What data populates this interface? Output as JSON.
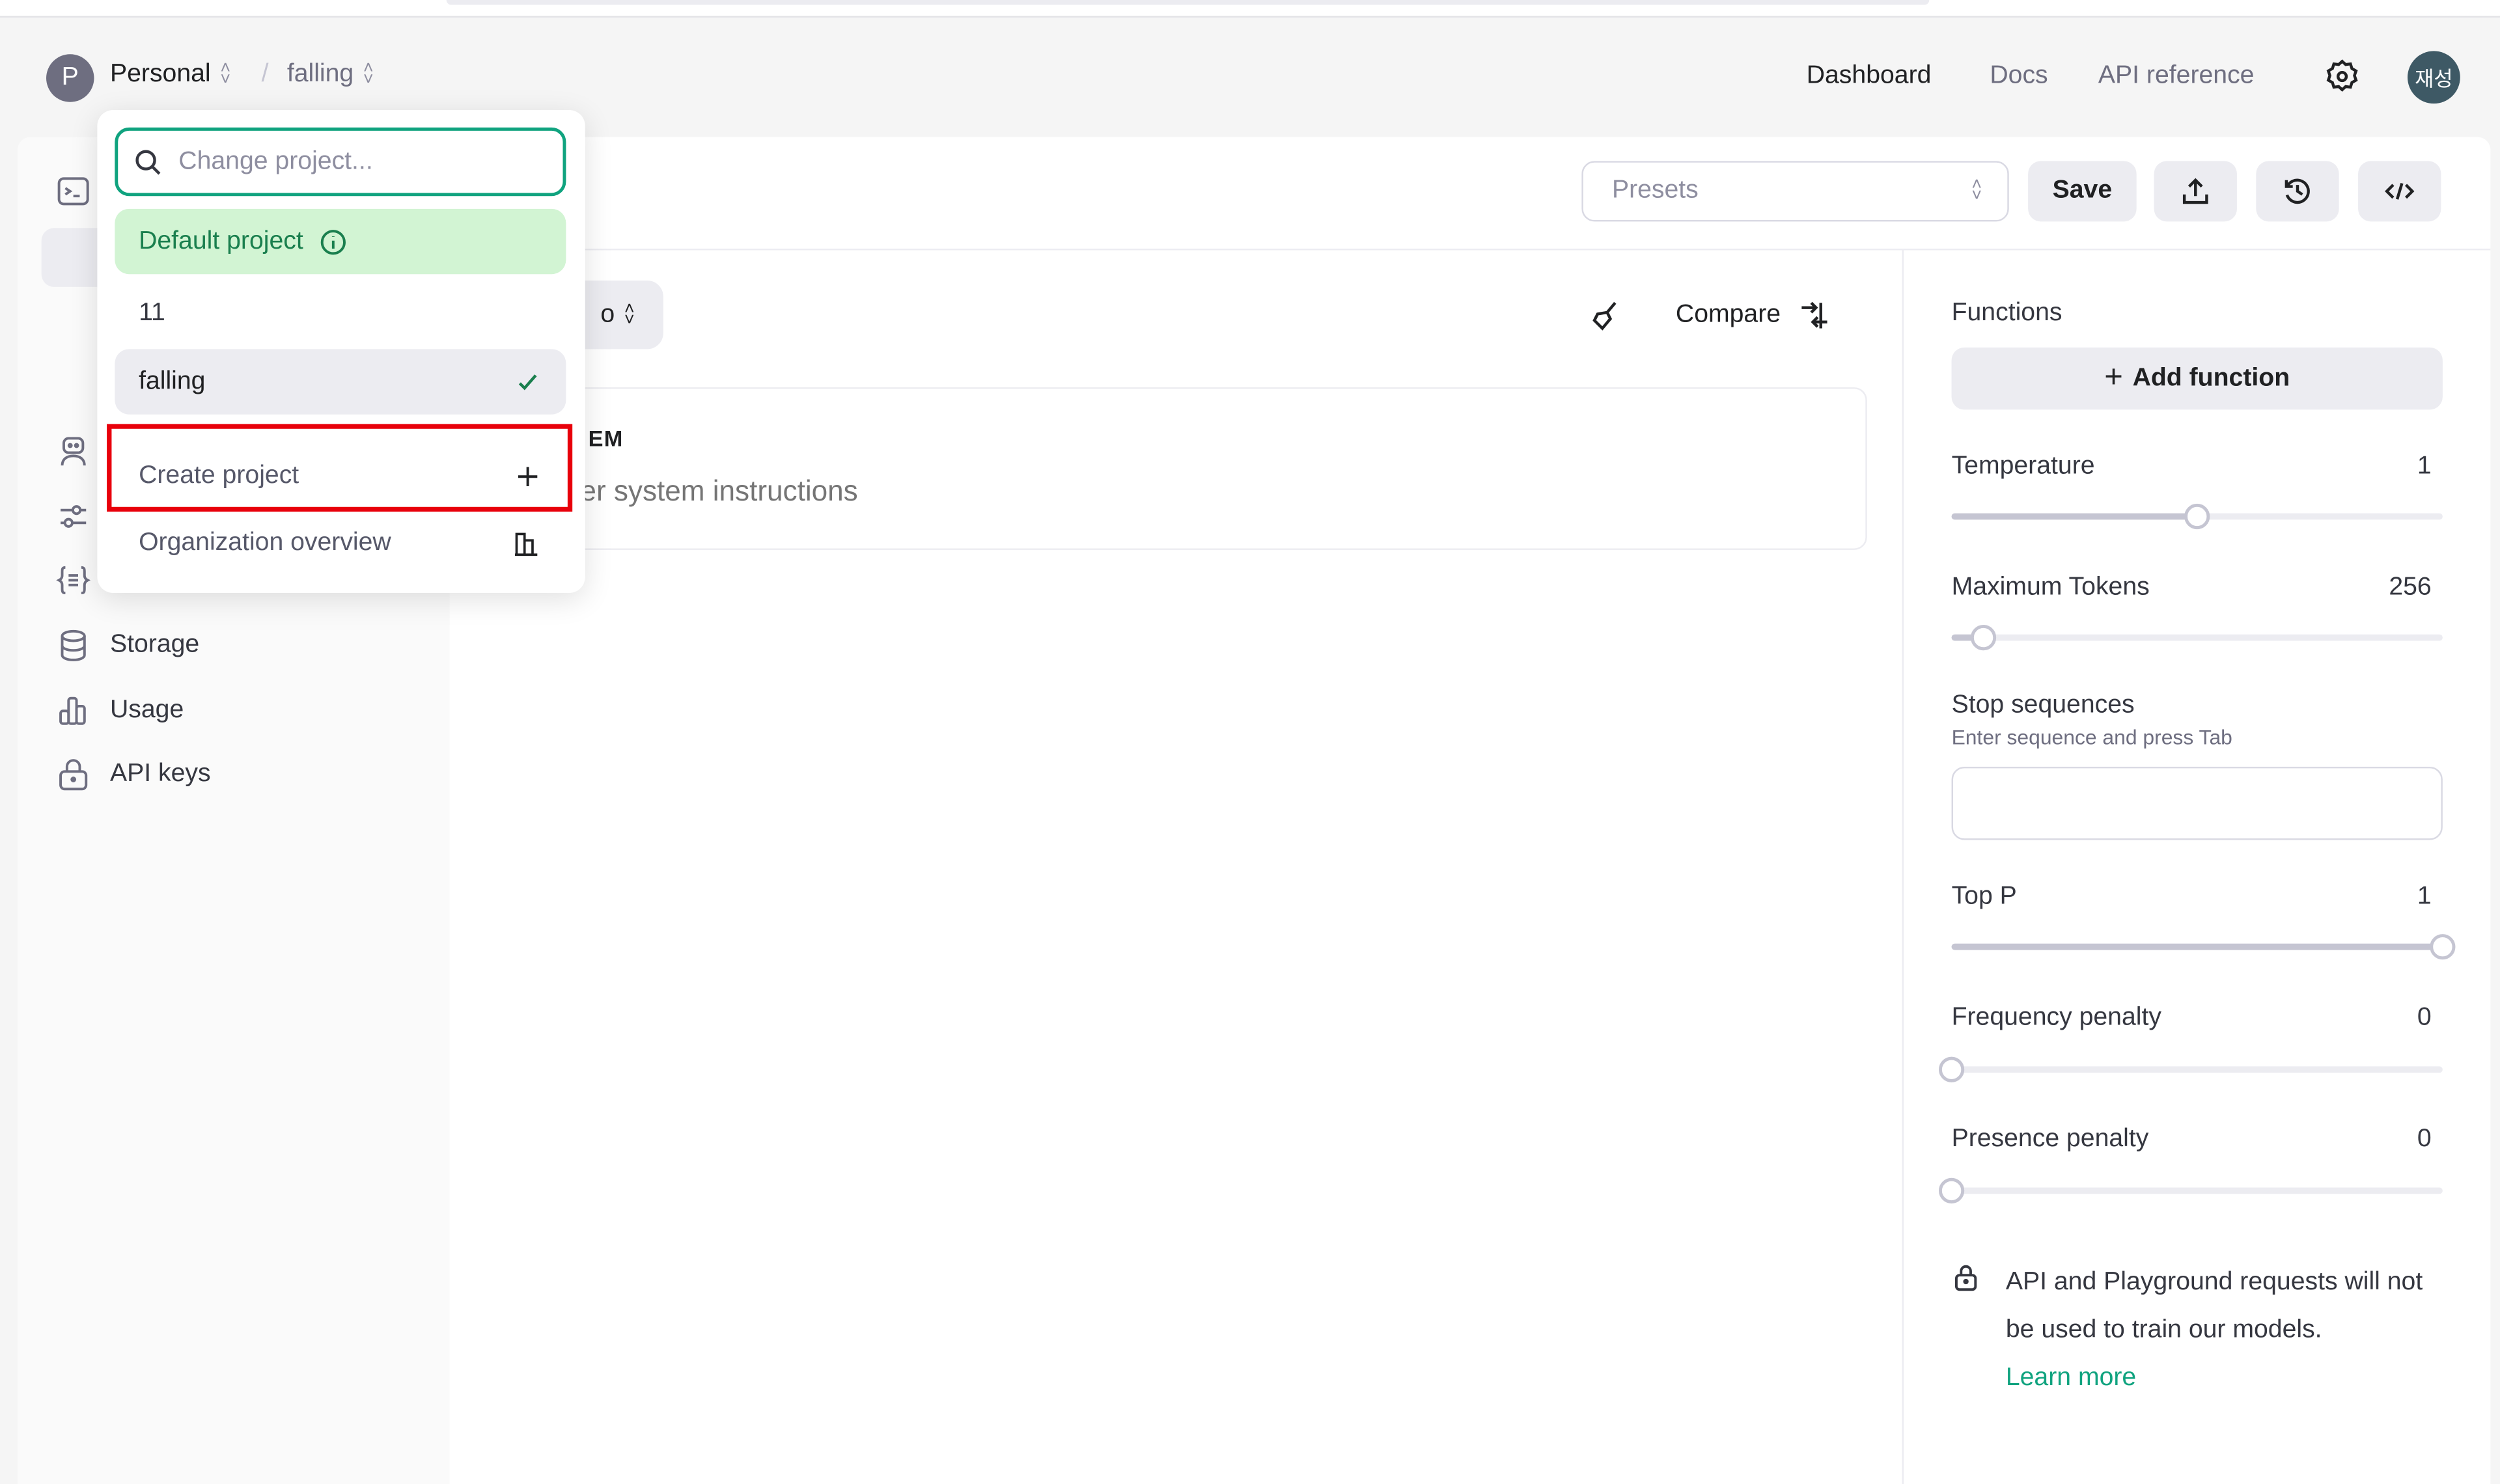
{
  "header": {
    "org_initial": "P",
    "org_name": "Personal",
    "separator": "/",
    "project_name": "falling",
    "nav": [
      {
        "label": "Dashboard",
        "active": true
      },
      {
        "label": "Docs",
        "active": false
      },
      {
        "label": "API reference",
        "active": false
      }
    ],
    "settings_icon": "gear-icon",
    "user_avatar": "재성"
  },
  "sidebar": {
    "items": [
      {
        "label": "Storage",
        "icon": "database-icon"
      },
      {
        "label": "Usage",
        "icon": "bar-chart-icon"
      },
      {
        "label": "API keys",
        "icon": "lock-icon"
      }
    ],
    "icons_partially_hidden": [
      "terminal-icon",
      "robot-icon",
      "sliders-icon",
      "braces-icon"
    ]
  },
  "toolbar": {
    "presets_placeholder": "Presets",
    "save_label": "Save",
    "share_icon": "upload-icon",
    "history_icon": "history-icon",
    "code_icon": "code-icon"
  },
  "editor": {
    "model_selector_visible_text": "o",
    "clear_icon": "broom-icon",
    "compare_label": "Compare",
    "system_label_visible": "EM",
    "system_placeholder_visible": "er system instructions"
  },
  "settings": {
    "functions_label": "Functions",
    "add_function_label": "Add function",
    "temperature": {
      "label": "Temperature",
      "value": "1",
      "fraction": 0.5
    },
    "max_tokens": {
      "label": "Maximum Tokens",
      "value": "256",
      "fraction": 0.065
    },
    "stop_sequences": {
      "label": "Stop sequences",
      "hint": "Enter sequence and press Tab",
      "value": ""
    },
    "top_p": {
      "label": "Top P",
      "value": "1",
      "fraction": 1.0
    },
    "frequency_penalty": {
      "label": "Frequency penalty",
      "value": "0",
      "fraction": 0.0
    },
    "presence_penalty": {
      "label": "Presence penalty",
      "value": "0",
      "fraction": 0.0
    },
    "notice_text": "API and Playground requests will not be used to train our models.",
    "learn_more": "Learn more"
  },
  "project_dropdown": {
    "search_placeholder": "Change project...",
    "search_value": "",
    "projects": [
      {
        "label": "Default project",
        "info_icon": true,
        "highlighted": true
      },
      {
        "label": "11",
        "selected": false
      },
      {
        "label": "falling",
        "selected": true
      }
    ],
    "create_project_label": "Create project",
    "organization_overview_label": "Organization overview"
  },
  "colors": {
    "accent": "#10a37f",
    "default_project_bg": "#d2f4d3",
    "highlight_box": "#e8000b",
    "avatar_bg": "#3e5965"
  }
}
